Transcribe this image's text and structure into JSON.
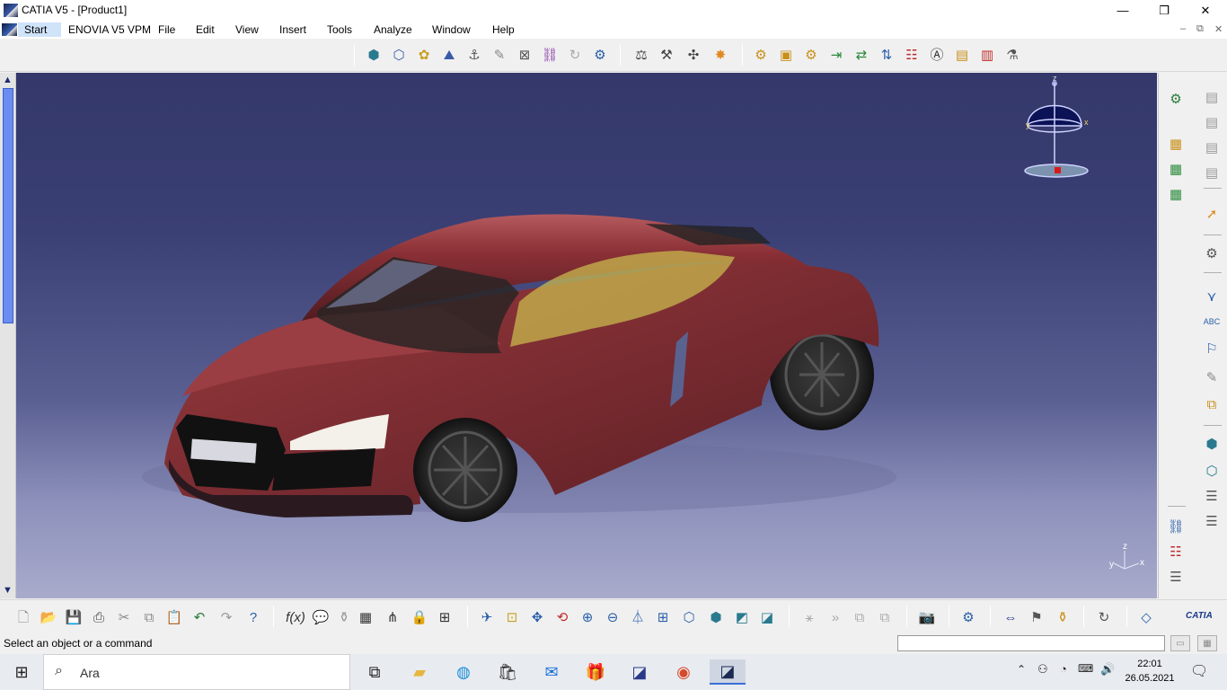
{
  "window": {
    "title": "CATIA V5 - [Product1]",
    "minimize": "—",
    "restore": "❐",
    "close": "✕"
  },
  "menu": {
    "items": [
      "Start",
      "ENOVIA V5 VPM",
      "File",
      "Edit",
      "View",
      "Insert",
      "Tools",
      "Analyze",
      "Window",
      "Help"
    ],
    "mdi_minimize": "–",
    "mdi_restore": "⧉",
    "mdi_close": "✕"
  },
  "top_toolbar": {
    "icons": [
      "product-icon",
      "part-icon",
      "component-icon",
      "assembly-icon",
      "move-icon",
      "sketch-icon",
      "select-icon",
      "link-icon",
      "refresh-icon",
      "gear-icon",
      "constraint-icon",
      "fix-icon",
      "snap-icon",
      "explode-icon",
      "settings-icon",
      "catalog-icon",
      "doc-icon",
      "insert-icon",
      "replace-icon",
      "reorder-icon",
      "graph-icon",
      "text-icon",
      "stamp-icon",
      "filter-icon"
    ]
  },
  "right_toolbar": {
    "icons": [
      "gear-icon",
      "doc-stack-icon",
      "doc-stack-icon",
      "doc-stack-icon",
      "doc-stack-icon",
      "product-stack-icon",
      "product-add-icon",
      "product-check-icon",
      "cursor-icon",
      "gear-select-icon",
      "measure-icon",
      "abc-annotation-icon",
      "flag-icon",
      "pencil-icon",
      "layers-icon",
      "cube-icon",
      "cube-alt-icon",
      "tree-icon",
      "tree-alt-icon",
      "tree-link-icon",
      "tree-select-icon",
      "tree-export-icon"
    ]
  },
  "bottom_toolbar": {
    "icons": [
      "new-icon",
      "open-icon",
      "save-icon",
      "print-icon",
      "cut-icon",
      "copy-icon",
      "paste-icon",
      "undo-icon",
      "redo-icon",
      "help-icon",
      "formula-icon",
      "comment-icon",
      "knowledge-icon",
      "table-icon",
      "tree-icon",
      "lock-icon",
      "tree-expand-icon",
      "fly-icon",
      "fit-all-icon",
      "pan-icon",
      "rotate-icon",
      "zoom-in-icon",
      "zoom-out-icon",
      "normal-view-icon",
      "multi-view-icon",
      "iso-view-icon",
      "render-icon",
      "hide-show-icon",
      "swap-icon",
      "cut-section-icon",
      "arrow-icon",
      "stack-icon",
      "stack2-icon",
      "camera-icon",
      "workbench-icon",
      "measure-icon",
      "pin-icon",
      "bottle-icon",
      "refresh-icon",
      "part-icon"
    ],
    "brand": "CATIA"
  },
  "status": {
    "message": "Select an object or a command",
    "command_placeholder": ""
  },
  "compass": {
    "z": "z",
    "x": "x",
    "y": "y"
  },
  "axes": {
    "z": "z",
    "x": "x",
    "y": "y"
  },
  "taskbar": {
    "search_label": "Ara",
    "apps": [
      "task-view-icon",
      "file-explorer-icon",
      "edge-icon",
      "store-icon",
      "mail-icon",
      "gift-icon",
      "catia-icon",
      "chrome-icon",
      "catia-active-icon"
    ],
    "time": "22:01",
    "date": "26.05.2021"
  },
  "colors": {
    "viewport_top": "#34386a",
    "viewport_bottom": "#a9abcc",
    "car_body": "#7a2a2e",
    "scrollbar_thumb": "#6b8cf0"
  }
}
